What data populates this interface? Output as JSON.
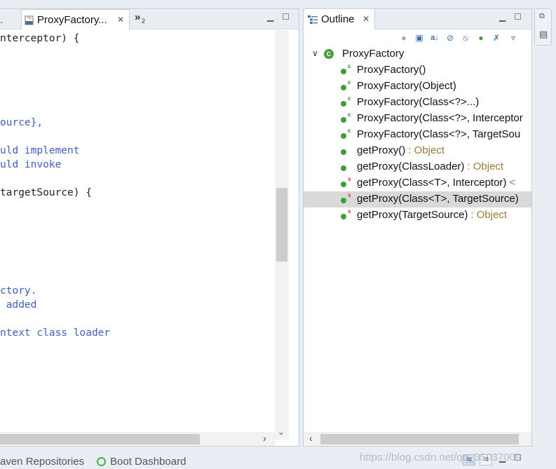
{
  "editor": {
    "prev_tab_fragment": ".",
    "active_tab_title": "ProxyFactory...",
    "overflow_count": "2",
    "code_lines": [
      {
        "text": "nterceptor) {",
        "kind": "code"
      },
      {
        "text": "ource},",
        "kind": "comment"
      },
      {
        "text": "uld implement",
        "kind": "comment"
      },
      {
        "text": "uld invoke",
        "kind": "comment"
      },
      {
        "text": "targetSource) {",
        "kind": "code"
      },
      {
        "text": "ctory.",
        "kind": "comment"
      },
      {
        "text": " added",
        "kind": "comment"
      },
      {
        "text": "ntext class loader",
        "kind": "comment"
      }
    ]
  },
  "outline": {
    "tab_title": "Outline",
    "toolbar_icons": [
      "collapse-all-icon",
      "link-editor-icon",
      "sort-icon",
      "hide-fields-icon",
      "hide-static-icon",
      "hide-non-public-icon",
      "hide-local-types-icon",
      "view-menu-icon"
    ],
    "root": {
      "label": "ProxyFactory",
      "icon": "class-icon"
    },
    "items": [
      {
        "label": "ProxyFactory()",
        "type": "",
        "deco": "c",
        "selected": false
      },
      {
        "label": "ProxyFactory(Object)",
        "type": "",
        "deco": "c",
        "selected": false
      },
      {
        "label": "ProxyFactory(Class<?>...)",
        "type": "",
        "deco": "c",
        "selected": false
      },
      {
        "label": "ProxyFactory(Class<?>, Interceptor",
        "type": "",
        "deco": "c",
        "selected": false
      },
      {
        "label": "ProxyFactory(Class<?>, TargetSou",
        "type": "",
        "deco": "c",
        "selected": false
      },
      {
        "label": "getProxy()",
        "type": ": Object",
        "deco": "",
        "selected": false
      },
      {
        "label": "getProxy(ClassLoader)",
        "type": ": Object",
        "deco": "",
        "selected": false
      },
      {
        "label": "getProxy(Class<T>, Interceptor)",
        "type": "<",
        "deco": "s",
        "selected": false
      },
      {
        "label": "getProxy(Class<T>, TargetSource)",
        "type": "",
        "deco": "s",
        "selected": true
      },
      {
        "label": "getProxy(TargetSource)",
        "type": ": Object",
        "deco": "s",
        "selected": false
      }
    ]
  },
  "bottom": {
    "maven_label": "aven Repositories",
    "boot_label": "Boot Dashboard",
    "watermark": "https://blog.csdn.net/qq_35037009"
  },
  "colors": {
    "comment": "#3f5fbf",
    "type_suffix": "#9a7b3a",
    "selection": "#d9d9d9",
    "method_public": "#3f9b3f",
    "static_deco": "#c0392b"
  }
}
